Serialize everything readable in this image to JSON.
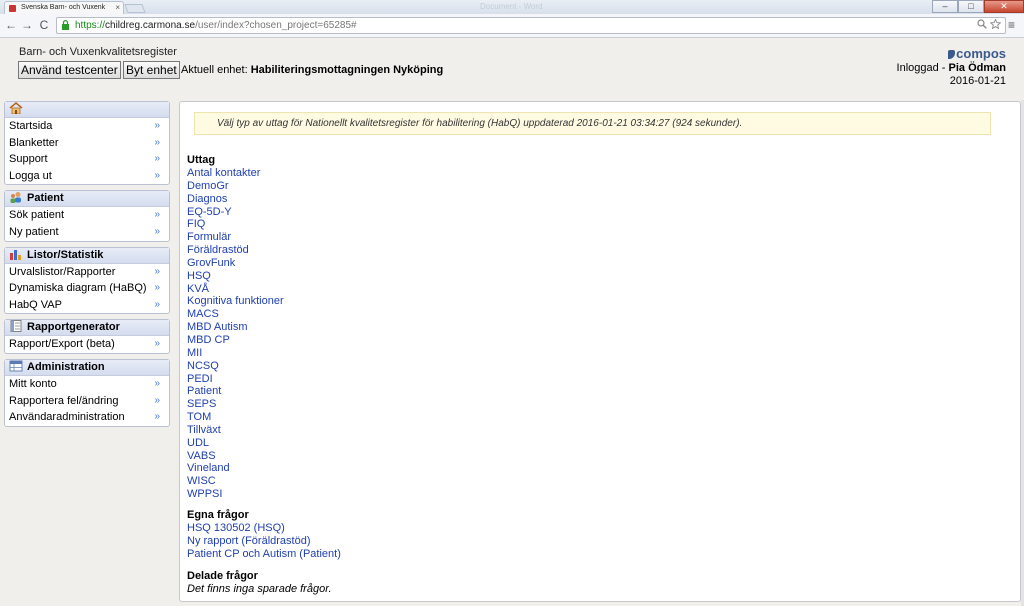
{
  "browser": {
    "tab_title": "Svenska Barn- och Vuxenk",
    "tab_close": "×",
    "window_title": "Document - Word",
    "url_scheme": "https://",
    "url_host": "childreg.carmona.se",
    "url_path": "/user/index?chosen_project=65285#",
    "back": "←",
    "forward": "→",
    "reload": "C",
    "menu": "≡",
    "minimize": "–",
    "maximize": "□",
    "close": "✕"
  },
  "header": {
    "site_title": "Barn- och Vuxenkvalitetsregister",
    "btn_testcenter": "Använd testcenter",
    "btn_byt_enhet": "Byt enhet",
    "unit_prefix": "Aktuell enhet: ",
    "unit_name": "Habiliteringsmottagningen Nyköping",
    "logo_text": "compos",
    "login_prefix": "Inloggad - ",
    "login_name": "Pia Ödman",
    "date": "2016-01-21"
  },
  "sidebar": {
    "chevron": "»",
    "home_items": [
      "Startsida",
      "Blanketter",
      "Support",
      "Logga ut"
    ],
    "patient_title": "Patient",
    "patient_items": [
      "Sök patient",
      "Ny patient"
    ],
    "listor_title": "Listor/Statistik",
    "listor_items": [
      "Urvalslistor/Rapporter",
      "Dynamiska diagram (HaBQ)",
      "HabQ VAP"
    ],
    "rapport_title": "Rapportgenerator",
    "rapport_items": [
      "Rapport/Export (beta)"
    ],
    "admin_title": "Administration",
    "admin_items": [
      "Mitt konto",
      "Rapportera fel/ändring",
      "Användaradministration"
    ]
  },
  "main": {
    "notice": "Välj typ av uttag för Nationellt kvalitetsregister för habilitering (HabQ) uppdaterad 2016-01-21 03:34:27 (924 sekunder).",
    "uttag_title": "Uttag",
    "uttag": [
      "Antal kontakter",
      "DemoGr",
      "Diagnos",
      "EQ-5D-Y",
      "FIQ",
      "Formulär",
      "Föräldrastöd",
      "GrovFunk",
      "HSQ",
      "KVÅ",
      "Kognitiva funktioner",
      "MACS",
      "MBD Autism",
      "MBD CP",
      "MII",
      "NCSQ",
      "PEDI",
      "Patient",
      "SEPS",
      "TOM",
      "Tillväxt",
      "UDL",
      "VABS",
      "Vineland",
      "WISC",
      "WPPSI"
    ],
    "egna_title": "Egna frågor",
    "egna": [
      "HSQ 130502 (HSQ)",
      "Ny rapport (Föräldrastöd)",
      "Patient CP och Autism (Patient)"
    ],
    "delade_title": "Delade frågor",
    "delade_empty": "Det finns inga sparade frågor."
  }
}
